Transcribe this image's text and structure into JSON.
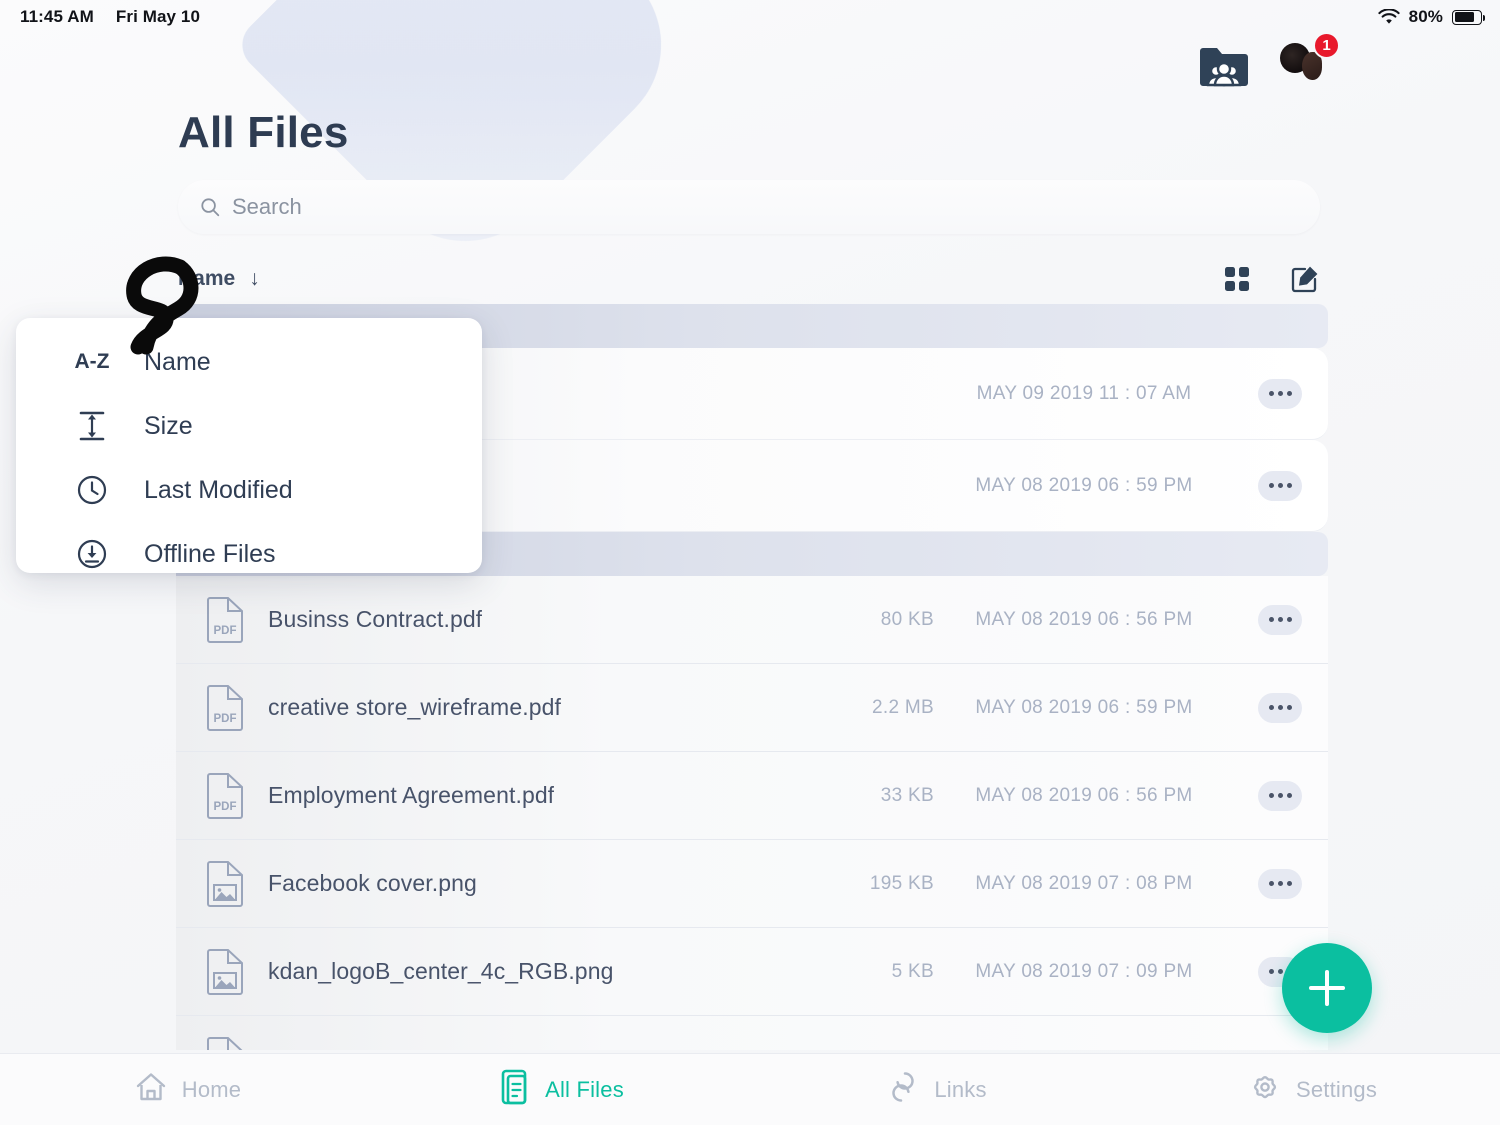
{
  "statusbar": {
    "time": "11:45 AM",
    "date": "Fri May 10",
    "battery_percent": "80%",
    "wifi_icon": "wifi-icon",
    "battery_icon": "battery-icon"
  },
  "header": {
    "title": "All Files",
    "shared_folder_icon": "shared-folder-icon",
    "avatar_icon": "user-avatar",
    "notification_count": "1"
  },
  "search": {
    "value": "",
    "placeholder": "Search",
    "icon": "search-icon"
  },
  "list_header": {
    "sort_label": "Name",
    "sort_direction_icon": "arrow-down-icon",
    "grid_view_icon": "grid-view-icon",
    "edit_icon": "edit-compose-icon"
  },
  "sort_menu": {
    "items": [
      {
        "label": "Name",
        "icon": "a-z-icon",
        "icon_text": "A-Z"
      },
      {
        "label": "Size",
        "icon": "size-arrows-icon",
        "icon_text": ""
      },
      {
        "label": "Last Modified",
        "icon": "clock-icon",
        "icon_text": ""
      },
      {
        "label": "Offline Files",
        "icon": "download-circle-icon",
        "icon_text": ""
      }
    ]
  },
  "files": {
    "columns": [
      "Name",
      "Size",
      "Last Modified"
    ],
    "rows": [
      {
        "type": "folder-band",
        "name": "",
        "size": "",
        "date": "",
        "icon": "folder-icon"
      },
      {
        "type": "hidden-name-file",
        "name": "",
        "size": "",
        "date": "MAY 09 2019 11 : 07 AM",
        "icon": "file-icon"
      },
      {
        "type": "hidden-name-file",
        "name": "",
        "size": "",
        "date": "MAY 08 2019 06 : 59 PM",
        "icon": "file-icon"
      },
      {
        "type": "folder-band",
        "name": "",
        "size": "",
        "date": "",
        "icon": "folder-icon"
      },
      {
        "type": "file",
        "name": "Businss Contract.pdf",
        "size": "80 KB",
        "date": "MAY 08 2019 06 : 56 PM",
        "icon": "pdf-file-icon"
      },
      {
        "type": "file",
        "name": "creative store_wireframe.pdf",
        "size": "2.2 MB",
        "date": "MAY 08 2019 06 : 59 PM",
        "icon": "pdf-file-icon"
      },
      {
        "type": "file",
        "name": "Employment Agreement.pdf",
        "size": "33 KB",
        "date": "MAY 08 2019 06 : 56 PM",
        "icon": "pdf-file-icon"
      },
      {
        "type": "file",
        "name": "Facebook cover.png",
        "size": "195 KB",
        "date": "MAY 08 2019 07 : 08 PM",
        "icon": "image-file-icon"
      },
      {
        "type": "file",
        "name": "kdan_logoB_center_4c_RGB.png",
        "size": "5 KB",
        "date": "MAY 08 2019 07 : 09 PM",
        "icon": "image-file-icon"
      },
      {
        "type": "partial",
        "name": "",
        "size": "",
        "date": "",
        "icon": "file-icon"
      }
    ],
    "more_icon": "more-options-icon"
  },
  "fab": {
    "label": "+",
    "icon": "add-icon"
  },
  "tabbar": {
    "items": [
      {
        "label": "Home",
        "icon": "home-icon",
        "active": false
      },
      {
        "label": "All Files",
        "icon": "files-icon",
        "active": true
      },
      {
        "label": "Links",
        "icon": "link-icon",
        "active": false
      },
      {
        "label": "Settings",
        "icon": "gear-icon",
        "active": false
      }
    ]
  },
  "colors": {
    "accent": "#0bbfa0",
    "title": "#2e3c52",
    "badge": "#e8192c",
    "muted": "#a9b2c4"
  }
}
